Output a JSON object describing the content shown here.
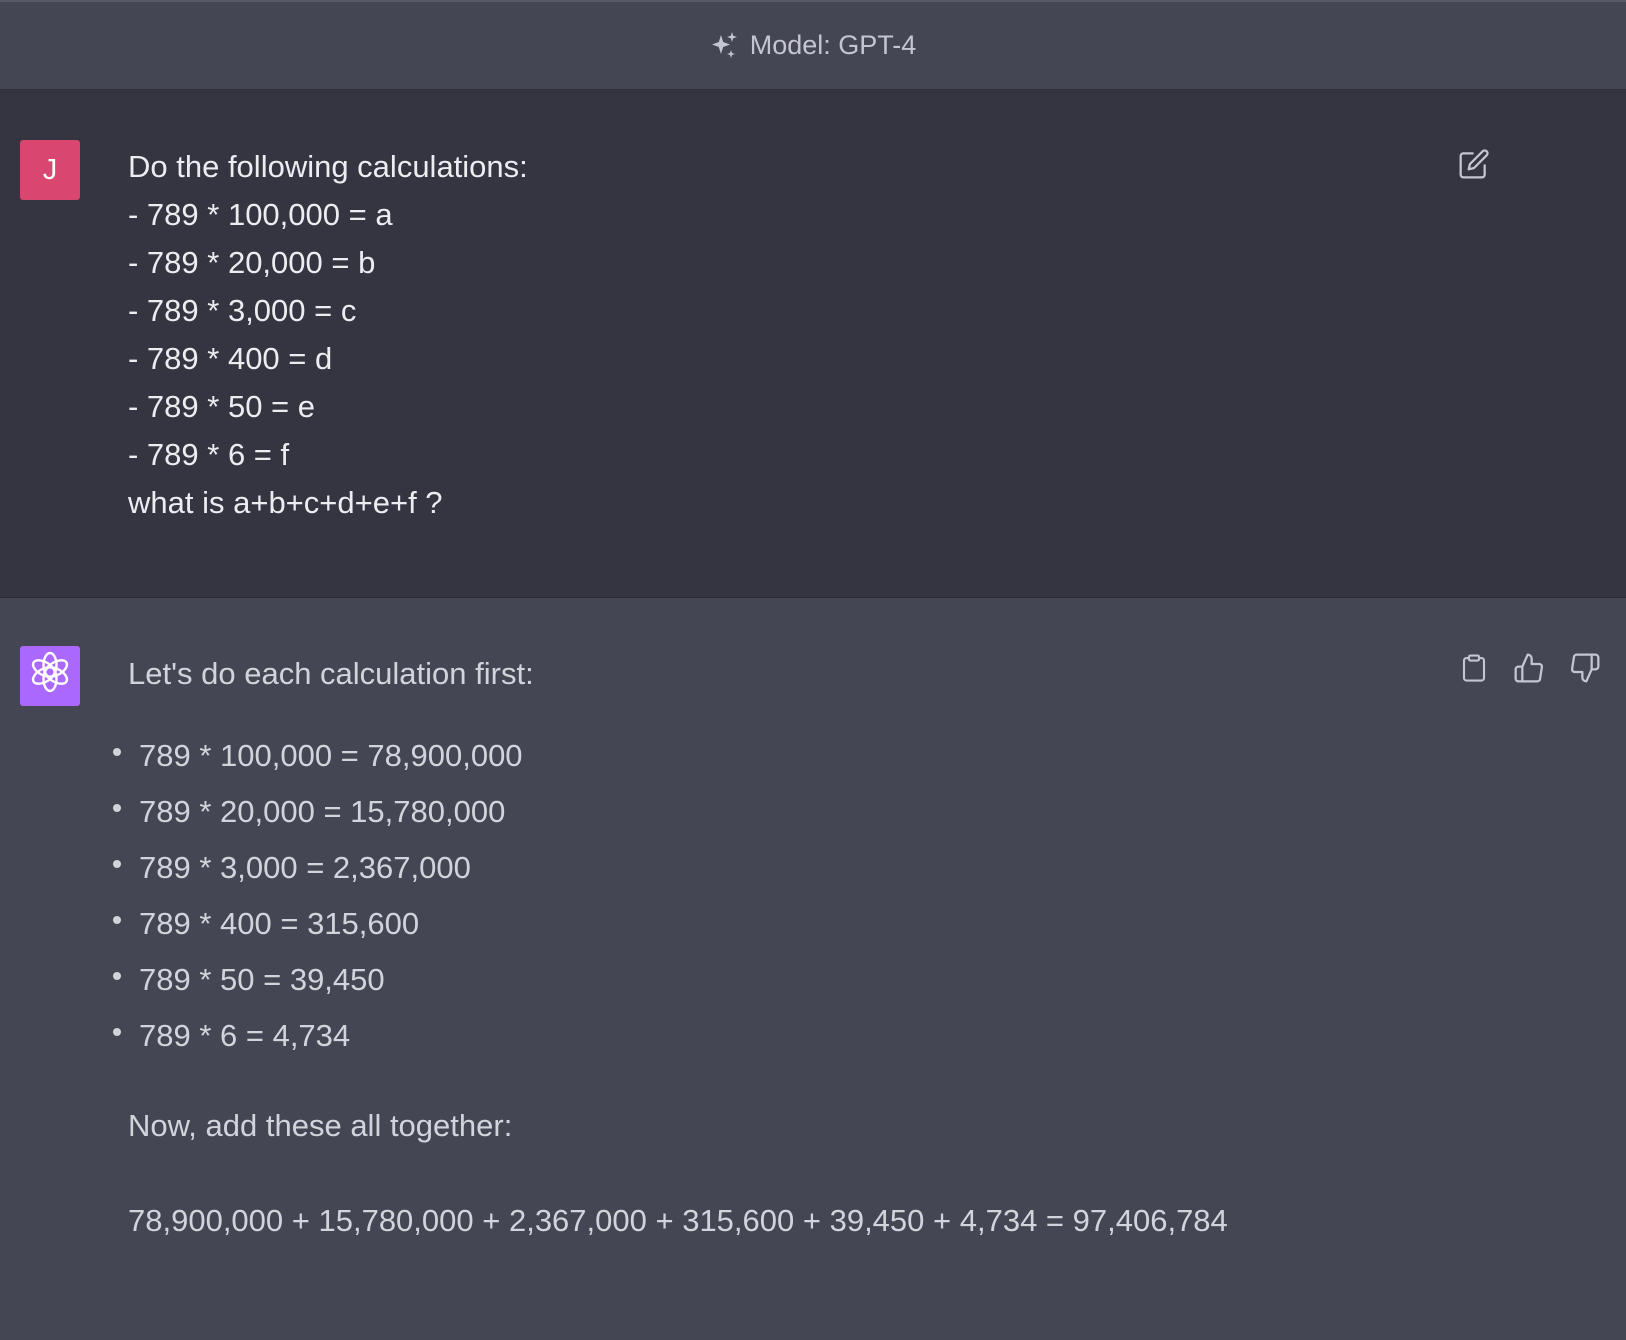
{
  "header": {
    "model_label": "Model: GPT-4",
    "icon": "sparkle-icon"
  },
  "user_message": {
    "avatar_letter": "J",
    "avatar_color": "#d9466f",
    "lines": [
      "Do the following calculations:",
      "- 789 * 100,000 = a",
      "- 789 * 20,000 = b",
      "- 789 * 3,000 = c",
      "- 789 * 400 = d",
      "- 789 * 50 = e",
      "- 789 * 6 = f",
      "what is a+b+c+d+e+f ?"
    ],
    "edit_icon": "edit-icon"
  },
  "assistant_message": {
    "avatar_icon": "openai-logo-icon",
    "avatar_color": "#ab68ff",
    "intro": "Let's do each calculation first:",
    "calculations": [
      "789 * 100,000 = 78,900,000",
      "789 * 20,000 = 15,780,000",
      "789 * 3,000 = 2,367,000",
      "789 * 400 = 315,600",
      "789 * 50 = 39,450",
      "789 * 6 = 4,734"
    ],
    "now_text": "Now, add these all together:",
    "sum_text": "78,900,000 + 15,780,000 + 2,367,000 + 315,600 + 39,450 + 4,734 = 97,406,784",
    "actions": [
      "copy-icon",
      "thumbs-up-icon",
      "thumbs-down-icon"
    ]
  }
}
